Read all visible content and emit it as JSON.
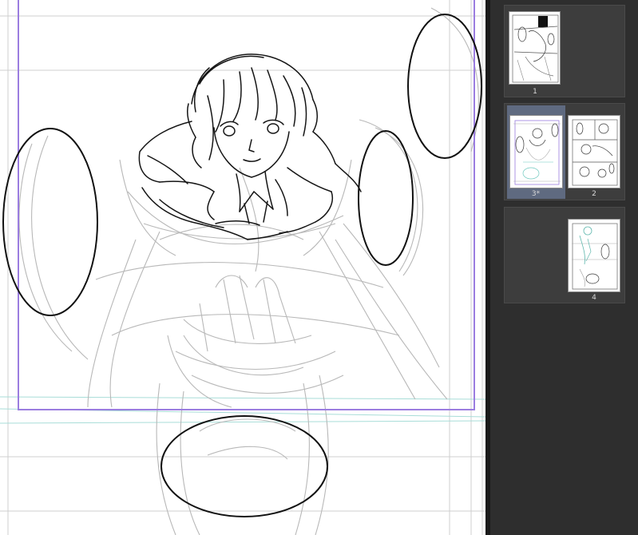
{
  "page_panel": {
    "spreads": [
      {
        "pages": [
          {
            "number": "1",
            "selected": false
          }
        ]
      },
      {
        "pages": [
          {
            "number": "3*",
            "selected": true
          },
          {
            "number": "2",
            "selected": false
          }
        ]
      },
      {
        "pages": [
          {
            "number": "4",
            "selected": false
          }
        ]
      }
    ]
  },
  "colors": {
    "frame_border": "#9b7de0",
    "panel_bg": "#2e2e2e",
    "spread_bg": "#3d3d3d",
    "selected_page_bg": "#5f6a80",
    "sketch_stroke": "#111111",
    "rough_stroke": "#b5b5b5",
    "guide_line": "#c8c8c8",
    "guide_cyan": "#a8ddd8"
  }
}
